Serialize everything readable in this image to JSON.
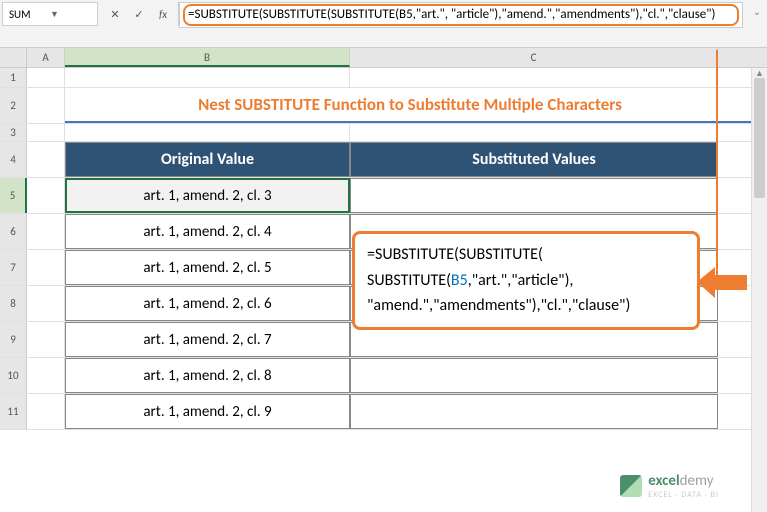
{
  "nameBox": {
    "value": "SUM"
  },
  "formulaBar": {
    "formula": "=SUBSTITUTE(SUBSTITUTE(SUBSTITUTE(B5,\"art.\", \"article\"),\"amend.\",\"amendments\"),\"cl.\",\"clause\")"
  },
  "columns": [
    "A",
    "B",
    "C"
  ],
  "rowNumbers": [
    "1",
    "2",
    "3",
    "4",
    "5",
    "6",
    "7",
    "8",
    "9",
    "10",
    "11"
  ],
  "title": "Nest SUBSTITUTE Function to Substitute Multiple Characters",
  "headers": {
    "colB": "Original Value",
    "colC": "Substituted Values"
  },
  "data": {
    "rows": [
      "art. 1, amend. 2, cl. 3",
      "art. 1, amend. 2, cl. 4",
      "art. 1, amend. 2, cl. 5",
      "art. 1, amend. 2, cl. 6",
      "art. 1, amend. 2, cl. 7",
      "art. 1, amend. 2, cl. 8",
      "art. 1, amend. 2, cl. 9"
    ]
  },
  "inlineFormula": {
    "line1a": "=SUBSTITUTE(SUBSTITUTE(",
    "line2a": "SUBSTITUTE(",
    "line2ref": "B5",
    "line2b": ",\"art.\",\"article\"),",
    "line3": "\"amend.\",\"amendments\"),\"cl.\",\"clause\")"
  },
  "watermark": {
    "brand1": "excel",
    "brand2": "demy",
    "tag": "EXCEL · DATA · BI"
  },
  "icons": {
    "times": "✕",
    "check": "✓",
    "fx": "fx",
    "dropdown": "▼",
    "expand": "⌄",
    "up": "▲"
  }
}
